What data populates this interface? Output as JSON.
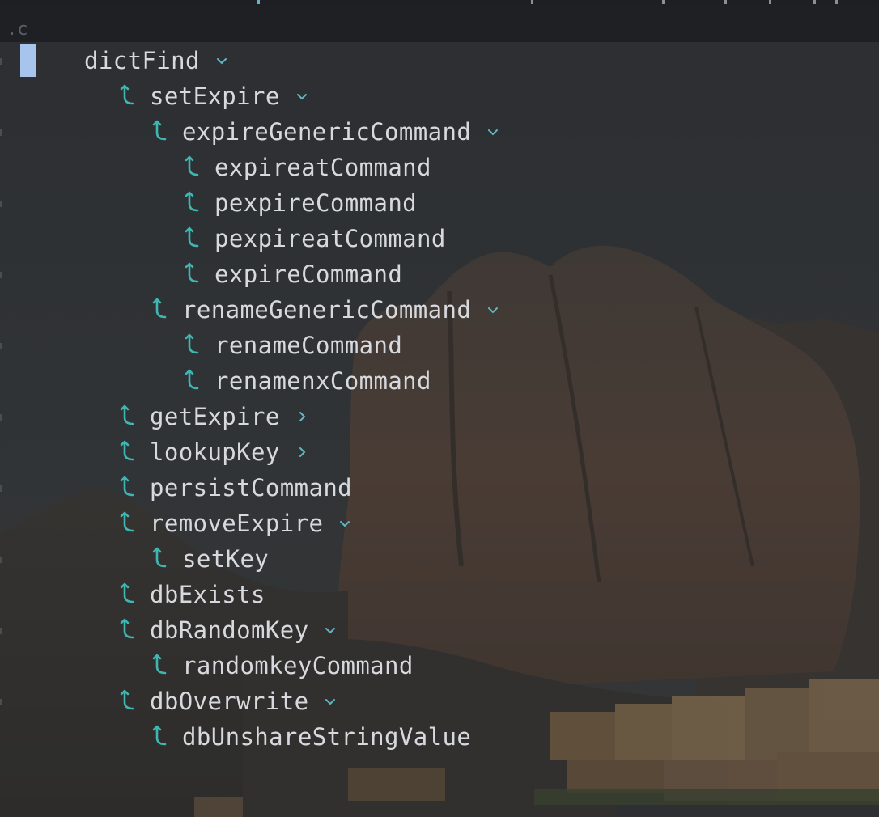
{
  "editor": {
    "file_extension": ".c"
  },
  "colors": {
    "text": "#d7d9de",
    "icon_accent": "#3fb6b2",
    "chevron": "#5fb8c6",
    "caret": "#a7c4ec",
    "background": "#2b2d30"
  },
  "call_hierarchy": {
    "root": {
      "label": "dictFind",
      "expanded": true
    },
    "items": [
      {
        "label": "setExpire",
        "level": 1,
        "chevron": "down",
        "icon": "call-site-icon"
      },
      {
        "label": "expireGenericCommand",
        "level": 2,
        "chevron": "down",
        "icon": "call-site-icon"
      },
      {
        "label": "expireatCommand",
        "level": 3,
        "chevron": "",
        "icon": "call-site-icon"
      },
      {
        "label": "pexpireCommand",
        "level": 3,
        "chevron": "",
        "icon": "call-site-icon"
      },
      {
        "label": "pexpireatCommand",
        "level": 3,
        "chevron": "",
        "icon": "call-site-icon"
      },
      {
        "label": "expireCommand",
        "level": 3,
        "chevron": "",
        "icon": "call-site-icon"
      },
      {
        "label": "renameGenericCommand",
        "level": 2,
        "chevron": "down",
        "icon": "call-site-icon"
      },
      {
        "label": "renameCommand",
        "level": 3,
        "chevron": "",
        "icon": "call-site-icon"
      },
      {
        "label": "renamenxCommand",
        "level": 3,
        "chevron": "",
        "icon": "call-site-icon"
      },
      {
        "label": "getExpire",
        "level": 1,
        "chevron": "right",
        "icon": "call-site-icon"
      },
      {
        "label": "lookupKey",
        "level": 1,
        "chevron": "right",
        "icon": "call-site-icon"
      },
      {
        "label": "persistCommand",
        "level": 1,
        "chevron": "",
        "icon": "call-site-icon"
      },
      {
        "label": "removeExpire",
        "level": 1,
        "chevron": "down",
        "icon": "call-site-icon"
      },
      {
        "label": "setKey",
        "level": 2,
        "chevron": "",
        "icon": "call-site-icon"
      },
      {
        "label": "dbExists",
        "level": 1,
        "chevron": "",
        "icon": "call-site-icon"
      },
      {
        "label": "dbRandomKey",
        "level": 1,
        "chevron": "down",
        "icon": "call-site-icon"
      },
      {
        "label": "randomkeyCommand",
        "level": 2,
        "chevron": "",
        "icon": "call-site-icon"
      },
      {
        "label": "dbOverwrite",
        "level": 1,
        "chevron": "down",
        "icon": "call-site-icon"
      },
      {
        "label": "dbUnshareStringValue",
        "level": 2,
        "chevron": "",
        "icon": "call-site-icon"
      }
    ]
  }
}
